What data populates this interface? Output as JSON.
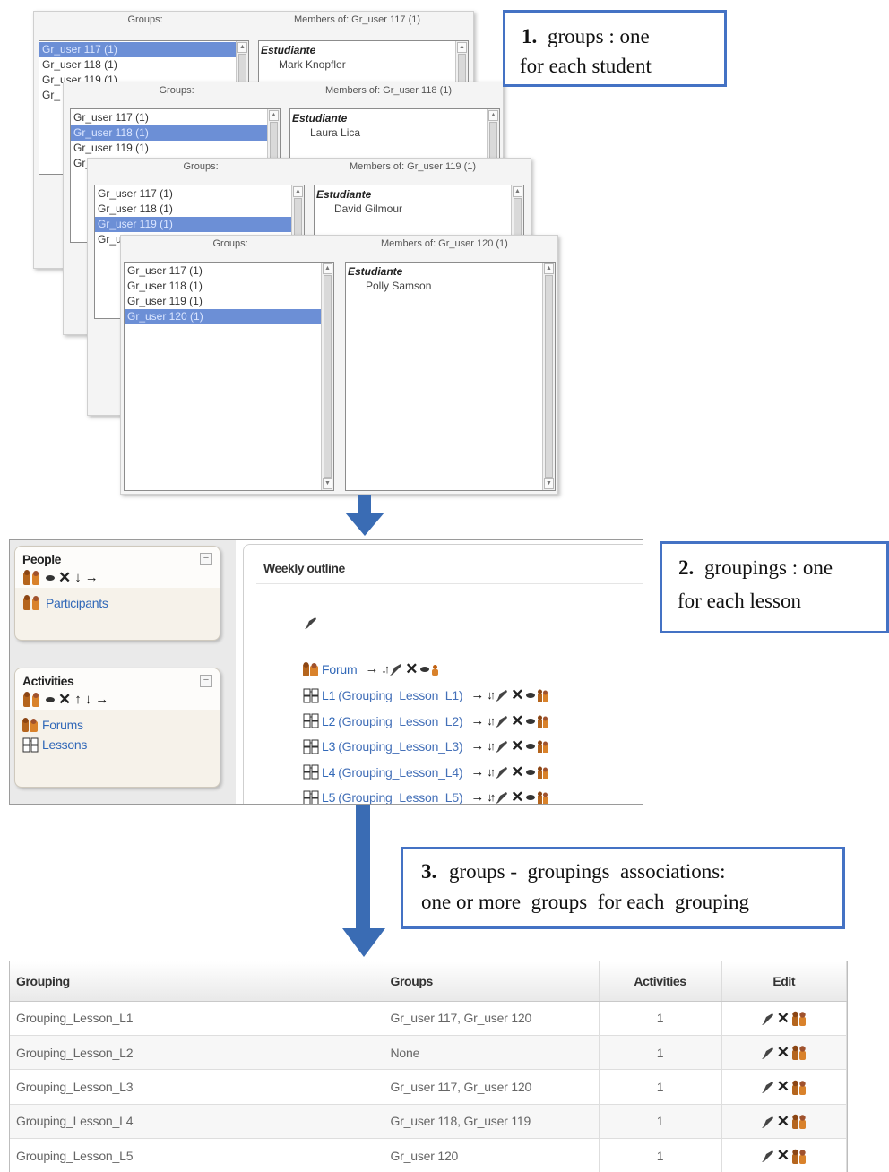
{
  "step1": {
    "callout": {
      "number": "1.",
      "line1": "groups : one",
      "line2": "for each student"
    },
    "panels": [
      {
        "groups_header": "Groups:",
        "members_header": "Members of: Gr_user 117 (1)",
        "groups": [
          "Gr_user 117 (1)",
          "Gr_user 118 (1)",
          "Gr_user 119 (1)",
          "Gr_"
        ],
        "selected": 0,
        "role": "Estudiante",
        "member": "Mark Knopfler"
      },
      {
        "groups_header": "Groups:",
        "members_header": "Members of: Gr_user 118 (1)",
        "groups": [
          "Gr_user 117 (1)",
          "Gr_user 118 (1)",
          "Gr_user 119 (1)",
          "Gr_"
        ],
        "selected": 1,
        "role": "Estudiante",
        "member": "Laura Lica"
      },
      {
        "groups_header": "Groups:",
        "members_header": "Members of: Gr_user 119 (1)",
        "groups": [
          "Gr_user 117 (1)",
          "Gr_user 118 (1)",
          "Gr_user 119 (1)",
          "Gr_u"
        ],
        "selected": 2,
        "role": "Estudiante",
        "member": "David Gilmour"
      },
      {
        "groups_header": "Groups:",
        "members_header": "Members of: Gr_user 120 (1)",
        "groups": [
          "Gr_user 117 (1)",
          "Gr_user 118 (1)",
          "Gr_user 119 (1)",
          "Gr_user 120 (1)"
        ],
        "selected": 3,
        "role": "Estudiante",
        "member": "Polly Samson"
      }
    ]
  },
  "step2": {
    "callout": {
      "number": "2.",
      "line1": "groupings : one",
      "line2": "for each lesson"
    },
    "blocks": {
      "people": {
        "title": "People",
        "link": "Participants"
      },
      "activities": {
        "title": "Activities",
        "links": [
          "Forums",
          "Lessons"
        ]
      }
    },
    "outline_title": "Weekly outline",
    "forum": "Forum",
    "lessons": [
      {
        "name": "L1",
        "grouping": "(Grouping_Lesson_L1)"
      },
      {
        "name": "L2",
        "grouping": "(Grouping_Lesson_L2)"
      },
      {
        "name": "L3",
        "grouping": "(Grouping_Lesson_L3)"
      },
      {
        "name": "L4",
        "grouping": "(Grouping_Lesson_L4)"
      },
      {
        "name": "L5",
        "grouping": "(Grouping_Lesson_L5)"
      }
    ]
  },
  "step3": {
    "callout": {
      "number": "3.",
      "line1": "groups -  groupings  associations:",
      "line2": "one or more  groups  for each  grouping"
    },
    "table": {
      "headers": [
        "Grouping",
        "Groups",
        "Activities",
        "Edit"
      ],
      "rows": [
        [
          "Grouping_Lesson_L1",
          "Gr_user 117, Gr_user 120",
          "1"
        ],
        [
          "Grouping_Lesson_L2",
          "None",
          "1"
        ],
        [
          "Grouping_Lesson_L3",
          "Gr_user 117, Gr_user 120",
          "1"
        ],
        [
          "Grouping_Lesson_L4",
          "Gr_user 118, Gr_user 119",
          "1"
        ],
        [
          "Grouping_Lesson_L5",
          "Gr_user 120",
          "1"
        ]
      ]
    }
  },
  "colors": {
    "callout_border": "#4472c4",
    "arrow_blue": "#3a6cb4",
    "selection": "#6c8fd6",
    "link_blue": "#3168b8"
  },
  "icons": [
    "people-icon",
    "eye-icon",
    "delete-icon",
    "move-down-icon",
    "move-up-icon",
    "move-right-icon",
    "edit-icon",
    "forum-icon",
    "lesson-icon",
    "user-icon",
    "roles-icon"
  ]
}
